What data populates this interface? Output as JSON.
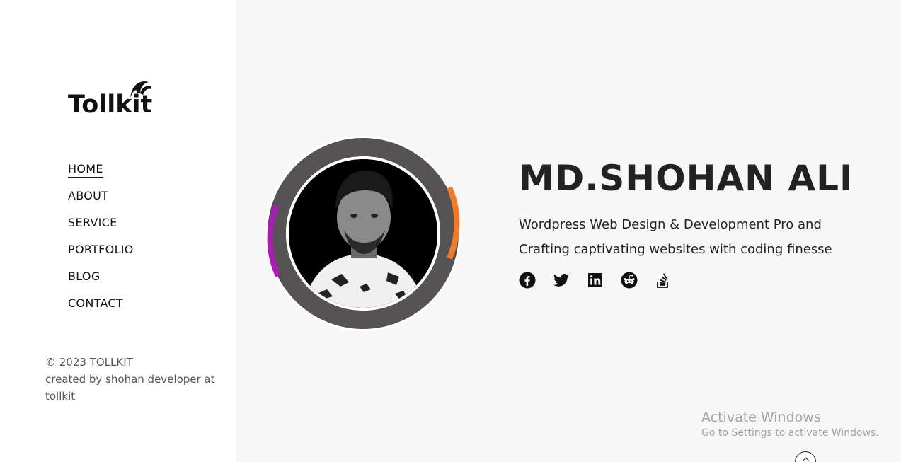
{
  "brand": {
    "logo_text": "Tollkit"
  },
  "nav": {
    "items": [
      {
        "label": "HOME"
      },
      {
        "label": "ABOUT"
      },
      {
        "label": "SERVICE"
      },
      {
        "label": "PORTFOLIO"
      },
      {
        "label": "BLOG"
      },
      {
        "label": "CONTACT"
      }
    ],
    "active": "HOME"
  },
  "footer": {
    "copyright": "© 2023 TOLLKIT",
    "credit": "created by shohan developer at tollkit"
  },
  "hero": {
    "name": "MD.SHOHAN ALI",
    "tagline": "Wordpress Web Design & Development Pro and Crafting captivating websites with coding finesse",
    "social_icons": [
      "facebook-icon",
      "twitter-icon",
      "linkedin-icon",
      "reddit-icon",
      "stackoverflow-icon"
    ]
  },
  "colors": {
    "ring": "#555354",
    "accent_left": "#a61fb0",
    "accent_right": "#f07a2a",
    "text": "#222222"
  },
  "watermark": {
    "title": "Activate Windows",
    "subtitle": "Go to Settings to activate Windows."
  }
}
